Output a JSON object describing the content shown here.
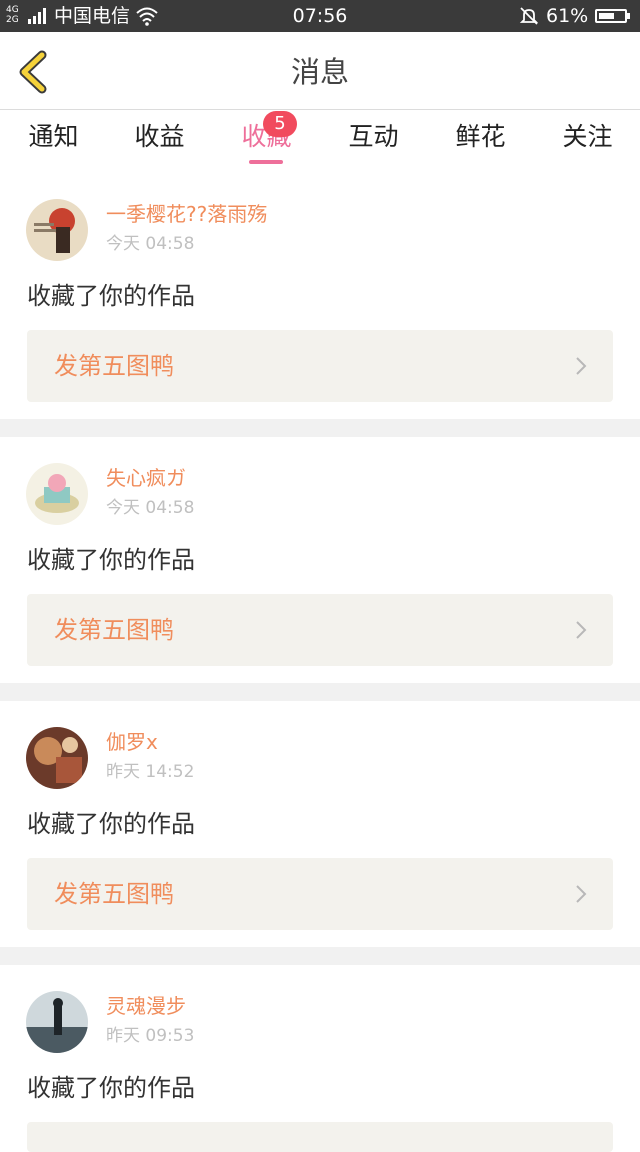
{
  "status_bar": {
    "network": "4G\n2G",
    "carrier": "中国电信",
    "time": "07:56",
    "battery_percent": "61%",
    "battery_level": 0.61
  },
  "header": {
    "title": "消息",
    "back_icon": "chevron-left-icon"
  },
  "tabs": [
    {
      "label": "通知",
      "active": false
    },
    {
      "label": "收益",
      "active": false
    },
    {
      "label": "收藏",
      "active": true,
      "badge": "5"
    },
    {
      "label": "互动",
      "active": false
    },
    {
      "label": "鲜花",
      "active": false
    },
    {
      "label": "关注",
      "active": false
    }
  ],
  "messages": [
    {
      "user": "一季樱花??落雨殇",
      "time": "今天 04:58",
      "action": "收藏了你的作品",
      "work": "发第五图鸭"
    },
    {
      "user": "失心疯ガ",
      "time": "今天 04:58",
      "action": "收藏了你的作品",
      "work": "发第五图鸭"
    },
    {
      "user": "伽罗x",
      "time": "昨天 14:52",
      "action": "收藏了你的作品",
      "work": "发第五图鸭"
    },
    {
      "user": "灵魂漫步",
      "time": "昨天 09:53",
      "action": "收藏了你的作品",
      "work": ""
    }
  ],
  "colors": {
    "accent_pink": "#ee6f9a",
    "name_orange": "#f08d5c",
    "badge_red": "#f14b5e",
    "back_yellow": "#f5d23a"
  }
}
